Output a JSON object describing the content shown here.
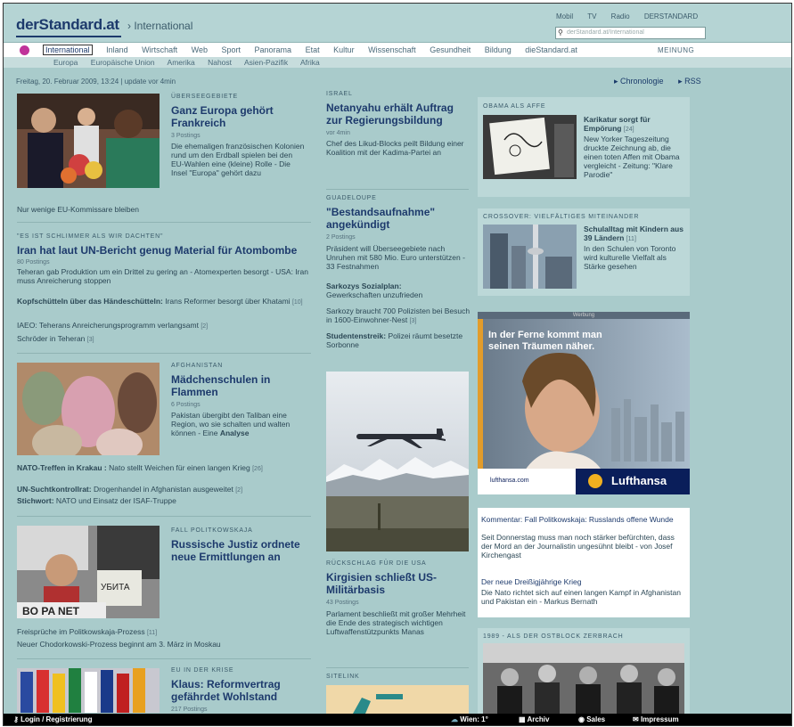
{
  "header": {
    "logo": "derStandard.at",
    "crumb": "› International",
    "toplinks": [
      "Mobil",
      "TV",
      "Radio",
      "DERSTANDARD"
    ],
    "search_placeholder": "derStandard.at/International"
  },
  "nav": {
    "items": [
      "International",
      "Inland",
      "Wirtschaft",
      "Web",
      "Sport",
      "Panorama",
      "Etat",
      "Kultur",
      "Wissenschaft",
      "Gesundheit",
      "Bildung",
      "dieStandard.at"
    ],
    "meinung": "MEINUNG",
    "sub": [
      "Europa",
      "Europäische Union",
      "Amerika",
      "Nahost",
      "Asien-Pazifik",
      "Afrika"
    ]
  },
  "dateline": "Freitag, 20. Februar 2009, 13:24 | update vor 4min",
  "tools": [
    "▸ Chronologie",
    "▸ RSS"
  ],
  "left": {
    "a1": {
      "kicker": "ÜBERSEEGEBIETE",
      "headline": "Ganz Europa gehört Frankreich",
      "meta": "3 Postings",
      "body": "Die ehemaligen französischen Kolonien rund um den Erdball spielen bei den EU-Wahlen eine (kleine) Rolle - Die Insel \"Europa\" gehört dazu",
      "more": "Nur wenige EU-Kommissare bleiben"
    },
    "a2": {
      "kicker": "\"ES IST SCHLIMMER ALS WIR DACHTEN\"",
      "headline": "Iran hat laut UN-Bericht genug Material für Atombombe",
      "meta": "80 Postings",
      "body": "Teheran gab Produktion um ein Drittel zu gering an - Atomexperten besorgt - USA: Iran muss Anreicherung stoppen",
      "l1b": "Kopfschütteln über das Händeschütteln:",
      "l1": " Irans Reformer besorgt über Khatami",
      "l1c": "[10]",
      "l2": "IAEO: Teherans Anreicherungsprogramm verlangsamt",
      "l2c": "[2]",
      "l3": "Schröder in Teheran",
      "l3c": "[3]"
    },
    "a3": {
      "kicker": "AFGHANISTAN",
      "headline": "Mädchenschulen in Flammen",
      "meta": "6 Postings",
      "body": "Pakistan übergibt den Taliban eine Region, wo sie schalten und walten können - Eine ",
      "bodyb": "Analyse",
      "l1b": "NATO-Treffen in Krakau :",
      "l1": " Nato stellt Weichen für einen langen Krieg",
      "l1c": "[26]",
      "l2b": "UN-Suchtkontrollrat:",
      "l2": " Drogenhandel in Afghanistan ausgeweitet",
      "l2c": "[2]",
      "l3b": "Stichwort:",
      "l3": " NATO und Einsatz der ISAF-Truppe"
    },
    "a4": {
      "kicker": "FALL POLITKOWSKAJA",
      "headline": "Russische Justiz ordnete neue Ermittlungen an",
      "l1": "Freisprüche im Politkowskaja-Prozess",
      "l1c": "[11]",
      "l2": "Neuer Chodorkowski-Prozess beginnt am 3. März in Moskau"
    },
    "a5": {
      "kicker": "EU IN DER KRISE",
      "headline": "Klaus: Reformvertrag gefährdet Wohlstand",
      "meta": "217 Postings"
    }
  },
  "middle": {
    "m1": {
      "kicker": "ISRAEL",
      "headline": "Netanyahu erhält Auftrag zur Regierungsbildung",
      "meta": "vor 4min",
      "body": "Chef des Likud-Blocks peilt Bildung einer Koalition mit der Kadima-Partei an"
    },
    "m2": {
      "kicker": "GUADELOUPE",
      "headline": "\"Bestandsaufnahme\" angekündigt",
      "meta": "2 Postings",
      "body": "Präsident will Überseegebiete nach Unruhen mit 580 Mio. Euro unterstützen - 33 Festnahmen",
      "l1b": "Sarkozys Sozialplan:",
      "l1": "Gewerkschaften unzufrieden",
      "l2": "Sarkozy braucht 700 Polizisten bei Besuch in 1600-Einwohner-Nest",
      "l2c": "[3]",
      "l3b": "Studentenstreik:",
      "l3": " Polizei räumt besetzte Sorbonne"
    },
    "m3": {
      "kicker": "RÜCKSCHLAG FÜR DIE USA",
      "headline": "Kirgisien schließt US-Militärbasis",
      "meta": "43 Postings",
      "body": "Parlament beschließt mit großer Mehrheit die Ende des strategisch wichtigen Luftwaffenstützpunkts Manas"
    },
    "sitelink": "SITELINK"
  },
  "right": {
    "r1": {
      "kicker": "OBAMA ALS AFFE",
      "headline": "Karikatur sorgt für Empörung",
      "count": "[24]",
      "body": "New Yorker Tageszeitung druckte Zeichnung ab, die einen toten Affen mit Obama vergleicht - Zeitung: \"Klare Parodie\""
    },
    "r2": {
      "kicker": "CROSSOVER: VIELFÄLTIGES MITEINANDER",
      "headline": "Schulalltag mit Kindern aus 39 Ländern",
      "count": "[11]",
      "body": "In den Schulen von Toronto wird kulturelle Vielfalt als Stärke gesehen"
    },
    "ad": {
      "label": "Werbung",
      "line1": "In der Ferne kommt man",
      "line2": "seinen Träumen näher.",
      "url": "lufthansa.com",
      "brand": "Lufthansa"
    },
    "comment": {
      "t1": "Kommentar: Fall Politkowskaja: Russlands offene Wunde",
      "b1": "Seit Donnerstag muss man noch stärker befürchten, dass der Mord an der Journalistin ungesühnt bleibt - von Josef Kirchengast",
      "t2": "Der neue Dreißigjährige Krieg",
      "b2": "Die Nato richtet sich auf einen langen Kampf in Afghanistan und Pakistan ein - Markus Bernath"
    },
    "r3": {
      "kicker": "1989 - ALS DER OSTBLOCK ZERBRACH"
    }
  },
  "footer": {
    "login": "Login / Registrierung",
    "weather": "Wien: 1°",
    "archiv": "Archiv",
    "sales": "Sales",
    "impressum": "Impressum"
  }
}
